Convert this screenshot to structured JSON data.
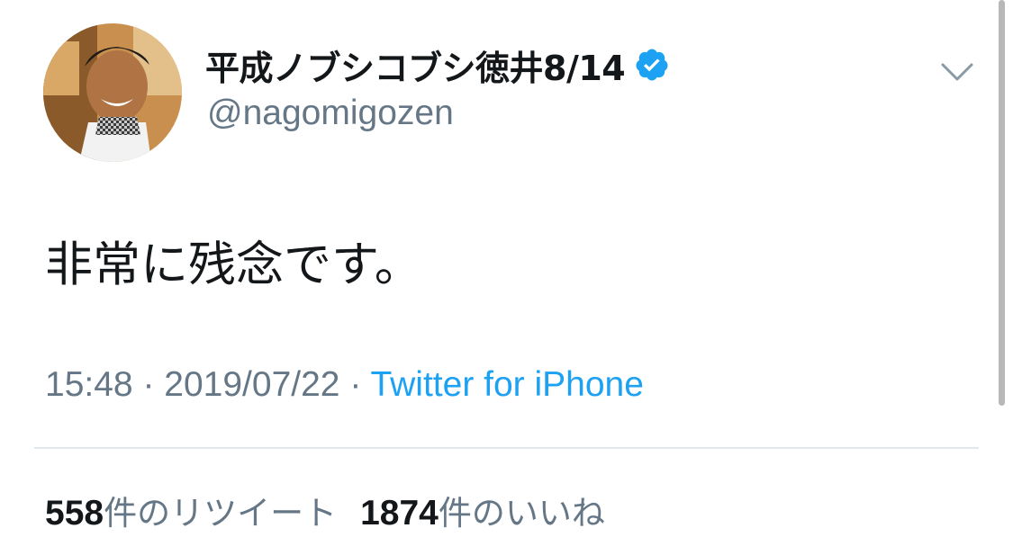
{
  "tweet": {
    "author": {
      "display_name": "平成ノブシコブシ徳井8/14",
      "handle": "@nagomigozen",
      "verified": true,
      "verified_icon": "verified-badge-icon",
      "avatar_icon": "profile-photo"
    },
    "menu_icon": "chevron-down-icon",
    "text": "非常に残念です。",
    "time": "15:48",
    "date": "2019/07/22",
    "separator": " · ",
    "source": "Twitter for iPhone",
    "stats": {
      "retweets_count": "558",
      "retweets_label": "件のリツイート",
      "likes_count": "1874",
      "likes_label": "件のいいね"
    }
  },
  "colors": {
    "text": "#14171a",
    "secondary": "#657786",
    "accent": "#1da1f2",
    "divider": "#e1e8ed"
  }
}
